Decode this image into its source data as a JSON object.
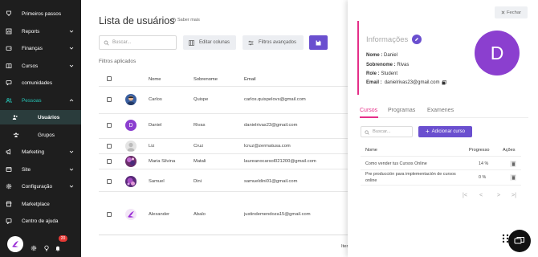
{
  "sidebar": {
    "items": [
      {
        "label": "Primeiros passos",
        "icon": "trophy-icon",
        "expandable": false
      },
      {
        "label": "Reports",
        "icon": "report-icon",
        "expandable": true
      },
      {
        "label": "Finanças",
        "icon": "wallet-icon",
        "expandable": true
      },
      {
        "label": "Cursos",
        "icon": "book-icon",
        "expandable": true
      },
      {
        "label": "comunidades",
        "icon": "community-icon",
        "expandable": false
      },
      {
        "label": "Pessoas",
        "icon": "people-icon",
        "expandable": true
      },
      {
        "label": "Usuários",
        "icon": "users-icon",
        "expandable": false
      },
      {
        "label": "Grupos",
        "icon": "groups-icon",
        "expandable": false
      },
      {
        "label": "Marketing",
        "icon": "megaphone-icon",
        "expandable": true
      },
      {
        "label": "Site",
        "icon": "globe-icon",
        "expandable": true
      },
      {
        "label": "Configuração",
        "icon": "gear-icon",
        "expandable": true
      },
      {
        "label": "Marketplace",
        "icon": "store-icon",
        "expandable": false
      },
      {
        "label": "Centro de ajuda",
        "icon": "help-icon",
        "expandable": false
      }
    ],
    "notification_count": "20"
  },
  "main": {
    "title": "Lista de usuários",
    "help_link": "Saber mais",
    "search_placeholder": "Buscar...",
    "edit_columns": "Editar colunas",
    "advanced_filters": "Filtros avançados",
    "applied_filters": "Filtros aplicados",
    "columns": [
      "Nome",
      "Sobrenome",
      "Email"
    ],
    "rows": [
      {
        "nome": "Carlos",
        "sobrenome": "Quispe",
        "email": "carlos.quispelovs@gmail.com",
        "avatar": "photo"
      },
      {
        "nome": "Daniel",
        "sobrenome": "Rivas",
        "email": "danielrivas23@gmail.com",
        "avatar": "D"
      },
      {
        "nome": "Liz",
        "sobrenome": "Cruz",
        "email": "lcruz@zermatusa.com",
        "avatar": "default"
      },
      {
        "nome": "Maria Silvina",
        "sobrenome": "Matali",
        "email": "laureanocarsol021200@gmail.com",
        "avatar": "photo"
      },
      {
        "nome": "Samuel",
        "sobrenome": "Dini",
        "email": "samueldini01@gmail.com",
        "avatar": "photo"
      },
      {
        "nome": "Alexander",
        "sobrenome": "Abalo",
        "email": "justindemendoza15@gmail.com",
        "avatar": "photo"
      }
    ],
    "footer_text": "Iten"
  },
  "panel": {
    "close_label": "Fechar",
    "info_title": "Informações",
    "avatar_letter": "D",
    "fields": [
      {
        "label": "Nome :",
        "value": "Daniel"
      },
      {
        "label": "Sobrenome :",
        "value": "Rivas"
      },
      {
        "label": "Role :",
        "value": "Student"
      },
      {
        "label": "Email :",
        "value": "danielrivas23@gmail.com"
      }
    ],
    "tabs": [
      "Cursos",
      "Programas",
      "Examenes"
    ],
    "search_placeholder": "Buscar...",
    "add_course": "Adicionar curso",
    "course_columns": [
      "Nome",
      "Progresso",
      "Ações"
    ],
    "courses": [
      {
        "name": "Como vender tus Cursos Online",
        "progress": "14 %"
      },
      {
        "name": "Pre producción para implementación de cursos online",
        "progress": "0 %"
      }
    ],
    "pager": [
      "|<",
      "<",
      ">",
      ">|"
    ]
  },
  "colors": {
    "primary": "#6a4fcf",
    "accent": "#e52e88",
    "sidebar_bg": "#1e1e1e",
    "active_teal": "#26c6b8"
  }
}
